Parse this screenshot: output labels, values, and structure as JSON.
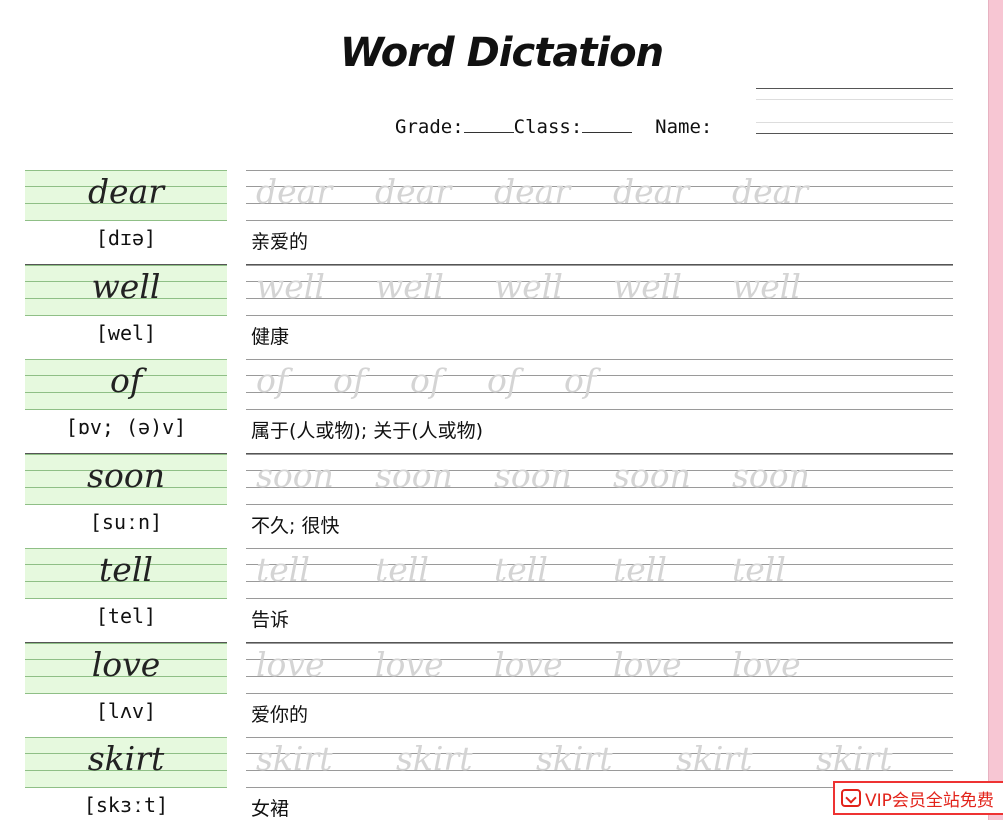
{
  "page": {
    "title": "Word Dictation"
  },
  "info": {
    "grade_label": "Grade:",
    "class_label": "Class:",
    "name_label": "Name:"
  },
  "entries": [
    {
      "word": "dear",
      "phonetic": "[dɪə]",
      "meaning": "亲爱的"
    },
    {
      "word": "well",
      "phonetic": "[wel]",
      "meaning": "健康"
    },
    {
      "word": "of",
      "phonetic": "[ɒv; (ə)v]",
      "meaning": "属于(人或物); 关于(人或物)"
    },
    {
      "word": "soon",
      "phonetic": "[suːn]",
      "meaning": "不久; 很快"
    },
    {
      "word": "tell",
      "phonetic": "[tel]",
      "meaning": "告诉"
    },
    {
      "word": "love",
      "phonetic": "[lʌv]",
      "meaning": "爱你的"
    },
    {
      "word": "skirt",
      "phonetic": "[skɜːt]",
      "meaning": "女裙"
    }
  ],
  "badge": {
    "text": "VIP会员全站免费",
    "icon": "vip-icon",
    "color": "#e2231a"
  }
}
